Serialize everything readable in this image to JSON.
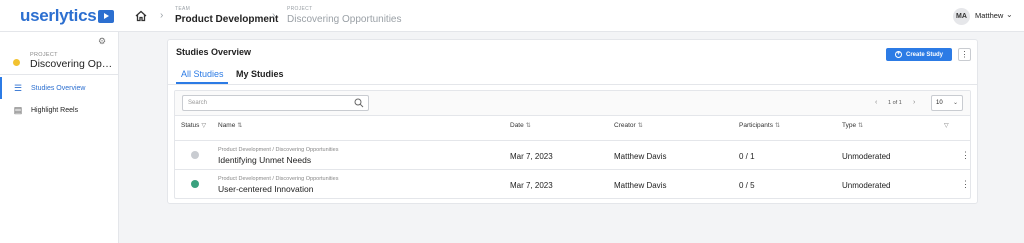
{
  "brand": {
    "logo_text": "userlytics",
    "accent": "#2c7be5"
  },
  "topbar": {
    "home_icon": "home-icon",
    "breadcrumbs": [
      {
        "label": "TEAM",
        "value": "Product Development"
      },
      {
        "label": "PROJECT",
        "value": "Discovering Opportunities"
      }
    ],
    "user": {
      "initials": "MA",
      "name": "Matthew"
    }
  },
  "sidebar": {
    "project_label": "PROJECT",
    "project_name": "Discovering Opportunities",
    "project_color": "#f2c230",
    "items": [
      {
        "label": "Studies Overview",
        "icon": "list-icon",
        "active": true
      },
      {
        "label": "Highlight Reels",
        "icon": "film-icon",
        "active": false
      }
    ]
  },
  "main": {
    "title": "Studies Overview",
    "create_button": "Create Study",
    "tabs": [
      {
        "label": "All Studies",
        "active": true
      },
      {
        "label": "My Studies",
        "active": false
      }
    ],
    "search": {
      "placeholder": "Search"
    },
    "pagination": {
      "text": "1 of 1",
      "rows_per_page": "10"
    },
    "columns": {
      "status": "Status",
      "name": "Name",
      "date": "Date",
      "creator": "Creator",
      "participants": "Participants",
      "type": "Type"
    },
    "rows": [
      {
        "status": "completed",
        "path": "Product Development / Discovering Opportunities",
        "name": "Identifying Unmet Needs",
        "date": "Mar 7, 2023",
        "creator": "Matthew Davis",
        "participants": "0 / 1",
        "type": "Unmoderated"
      },
      {
        "status": "active",
        "path": "Product Development / Discovering Opportunities",
        "name": "User-centered Innovation",
        "date": "Mar 7, 2023",
        "creator": "Matthew Davis",
        "participants": "0 / 5",
        "type": "Unmoderated"
      }
    ]
  }
}
